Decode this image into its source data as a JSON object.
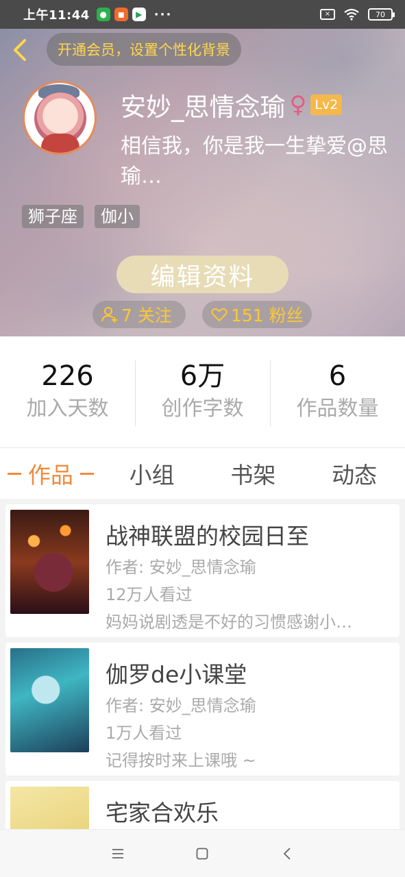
{
  "status_bar": {
    "time": "上午11:44",
    "more": "···",
    "battery": "70",
    "sim_label": "×"
  },
  "header": {
    "vip_banner": "开通会员，设置个性化背景",
    "username": "安妙_思情念瑜",
    "gender_symbol": "♀",
    "level": "Lv2",
    "bio": "相信我，你是我一生挚爱@思瑜…",
    "tags": [
      "狮子座",
      "伽小"
    ],
    "edit_button": "编辑资料",
    "following": "7 关注",
    "fans": "151 粉丝"
  },
  "stats": [
    {
      "value": "226",
      "label": "加入天数"
    },
    {
      "value": "6万",
      "label": "创作字数"
    },
    {
      "value": "6",
      "label": "作品数量"
    }
  ],
  "tabs": [
    {
      "label": "作品",
      "active": true
    },
    {
      "label": "小组",
      "active": false
    },
    {
      "label": "书架",
      "active": false
    },
    {
      "label": "动态",
      "active": false
    }
  ],
  "works": [
    {
      "title": "战神联盟的校园日至",
      "author": "作者: 安妙_思情念瑜",
      "views": "12万人看过",
      "desc": "妈妈说剧透是不好的习惯感谢小…"
    },
    {
      "title": "伽罗de小课堂",
      "author": "作者: 安妙_思情念瑜",
      "views": "1万人看过",
      "desc": "记得按时来上课哦 ~"
    },
    {
      "title": "宅家合欢乐",
      "author": "",
      "views": "",
      "desc": ""
    }
  ],
  "colors": {
    "accent": "#f08a3c",
    "vip_text": "#ffd84a",
    "level_badge": "#f5b84a",
    "edit_button": "#e7dcb6"
  },
  "icons": {
    "back": "chevron-left-icon",
    "female": "female-icon",
    "follow": "user-plus-icon",
    "fans": "heart-icon",
    "nav_menu": "menu-icon",
    "nav_home": "square-icon",
    "nav_back": "back-triangle-icon"
  }
}
